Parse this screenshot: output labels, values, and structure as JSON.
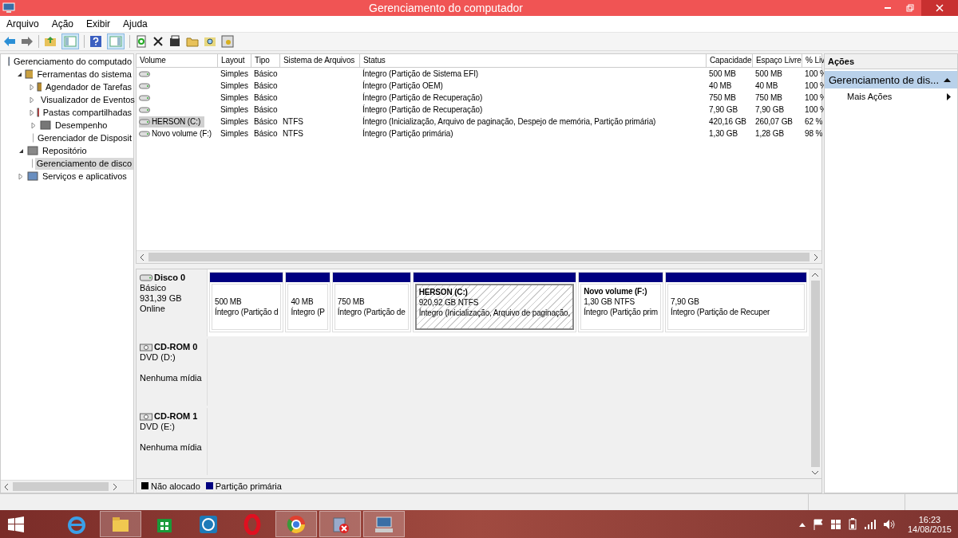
{
  "window": {
    "title": "Gerenciamento do computador"
  },
  "menu": [
    "Arquivo",
    "Ação",
    "Exibir",
    "Ajuda"
  ],
  "tree": [
    {
      "label": "Gerenciamento do computado",
      "selected": false,
      "children": [
        {
          "label": "Ferramentas do sistema",
          "selected": false,
          "expanded": true,
          "children": [
            {
              "label": "Agendador de Tarefas",
              "selected": false,
              "expanded": false
            },
            {
              "label": "Visualizador de Eventos",
              "selected": false,
              "expanded": false
            },
            {
              "label": "Pastas compartilhadas",
              "selected": false,
              "expanded": false
            },
            {
              "label": "Desempenho",
              "selected": false,
              "expanded": false
            },
            {
              "label": "Gerenciador de Disposit",
              "selected": false
            }
          ]
        },
        {
          "label": "Repositório",
          "selected": false,
          "expanded": true,
          "children": [
            {
              "label": "Gerenciamento de disco",
              "selected": true
            }
          ]
        },
        {
          "label": "Serviços e aplicativos",
          "selected": false,
          "expanded": false
        }
      ]
    }
  ],
  "table": {
    "columns": [
      "Volume",
      "Layout",
      "Tipo",
      "Sistema de Arquivos",
      "Status",
      "Capacidade",
      "Espaço Livre",
      "% Liv"
    ],
    "rows": [
      {
        "selected": false,
        "cells": [
          "",
          "Simples",
          "Básico",
          "",
          "Íntegro (Partição de Sistema EFI)",
          "500 MB",
          "500 MB",
          "100 %"
        ]
      },
      {
        "selected": false,
        "cells": [
          "",
          "Simples",
          "Básico",
          "",
          "Íntegro (Partição OEM)",
          "40 MB",
          "40 MB",
          "100 %"
        ]
      },
      {
        "selected": false,
        "cells": [
          "",
          "Simples",
          "Básico",
          "",
          "Íntegro (Partição de Recuperação)",
          "750 MB",
          "750 MB",
          "100 %"
        ]
      },
      {
        "selected": false,
        "cells": [
          "",
          "Simples",
          "Básico",
          "",
          "Íntegro (Partição de Recuperação)",
          "7,90 GB",
          "7,90 GB",
          "100 %"
        ]
      },
      {
        "selected": true,
        "cells": [
          "HERSON (C:)",
          "Simples",
          "Básico",
          "NTFS",
          "Íntegro (Inicialização, Arquivo de paginação, Despejo de memória, Partição primária)",
          "420,16 GB",
          "260,07 GB",
          "62 %"
        ]
      },
      {
        "selected": false,
        "cells": [
          "Novo volume (F:)",
          "Simples",
          "Básico",
          "NTFS",
          "Íntegro (Partição primária)",
          "1,30 GB",
          "1,28 GB",
          "98 %"
        ]
      }
    ]
  },
  "disks": [
    {
      "kind": "disk",
      "name": "Disco 0",
      "lines": [
        "Básico",
        "931,39 GB",
        "Online"
      ],
      "partitions": [
        {
          "selected": false,
          "lines": [
            "500 MB",
            "Íntegro (Partição d"
          ]
        },
        {
          "selected": false,
          "lines": [
            "40 MB",
            "Íntegro (P"
          ]
        },
        {
          "selected": false,
          "lines": [
            "750 MB",
            "Íntegro (Partição de"
          ]
        },
        {
          "selected": true,
          "title": "HERSON  (C:)",
          "lines": [
            "920,92 GB NTFS",
            "Íntegro (Inicialização, Arquivo de paginação,"
          ]
        },
        {
          "selected": false,
          "title": "Novo volume  (F:)",
          "lines": [
            "1,30 GB NTFS",
            "Íntegro (Partição prim"
          ]
        },
        {
          "selected": false,
          "lines": [
            "7,90 GB",
            "Íntegro (Partição de Recuper"
          ]
        }
      ]
    },
    {
      "kind": "cdrom",
      "name": "CD-ROM 0",
      "lines": [
        "DVD (D:)",
        "Nenhuma mídia"
      ]
    },
    {
      "kind": "cdrom",
      "name": "CD-ROM 1",
      "lines": [
        "DVD (E:)",
        "Nenhuma mídia"
      ]
    }
  ],
  "legend": [
    {
      "label": "Não alocado",
      "color": "#000000"
    },
    {
      "label": "Partição primária",
      "color": "#000080"
    }
  ],
  "actions": {
    "header": "Ações",
    "section": "Gerenciamento de dis...",
    "items": [
      "Mais Ações"
    ]
  },
  "taskbar_apps": [
    {
      "running": false
    },
    {
      "running": true
    },
    {
      "running": false
    },
    {
      "running": false
    },
    {
      "running": false
    },
    {
      "running": true
    },
    {
      "running": true
    },
    {
      "running": true
    }
  ],
  "clock": {
    "time": "16:23",
    "date": "14/08/2015"
  }
}
